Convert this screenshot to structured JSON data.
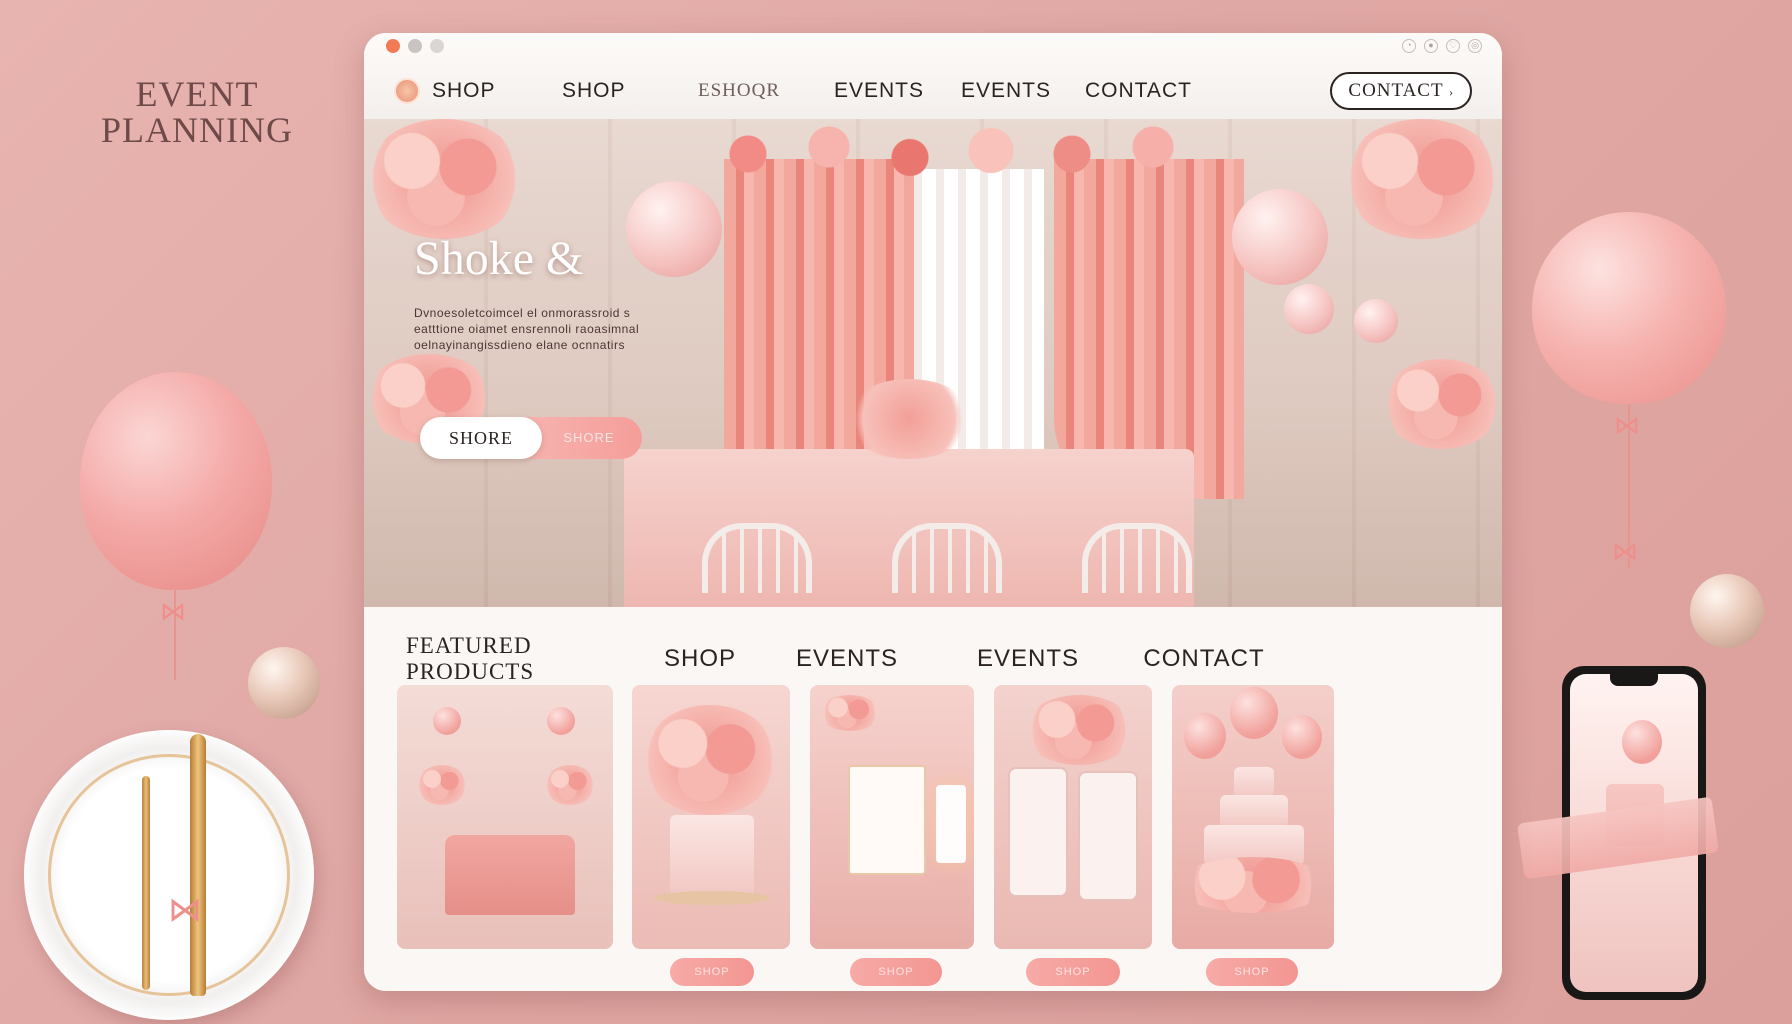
{
  "background": {
    "logo_line1": "EVENT",
    "logo_line2": "PLANNING"
  },
  "colors": {
    "background": "#e0a8a4",
    "accent_pink": "#f39692",
    "text_dark": "#2b2322",
    "window_bg": "#fbf7f4"
  },
  "nav": {
    "logo_icon": "flower-logo-icon",
    "items": [
      "SHOP",
      "SHOP",
      "ESHOQR",
      "EVENTS",
      "EVENTS",
      "CONTACT"
    ],
    "cta": "CONTACT"
  },
  "hero": {
    "title": "Shoke &",
    "text_line1": "Dvnoesoletcoimcel el onmorassroid s",
    "text_line2": "eatttione oiamet ensrennoli raoasimnal",
    "text_line3": "oelnayinangissdieno elane ocnnatirs",
    "button_primary": "SHORE",
    "button_secondary": "SHORE"
  },
  "featured": {
    "heading": "FEATURED PRODUCTS",
    "columns": [
      "SHOP",
      "EVENTS",
      "EVENTS",
      "CONTACT"
    ],
    "card_buttons": [
      "SHOP",
      "SHOP",
      "SHOP",
      "SHOP"
    ]
  }
}
